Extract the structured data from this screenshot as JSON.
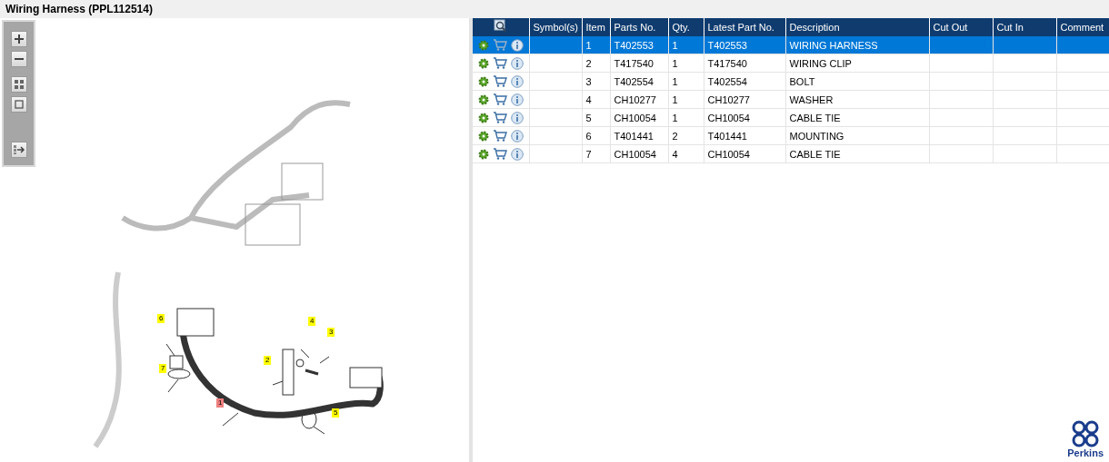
{
  "title": "Wiring Harness (PPL112514)",
  "callouts": [
    {
      "label": "1",
      "selected": true
    },
    {
      "label": "2",
      "selected": false
    },
    {
      "label": "3",
      "selected": false
    },
    {
      "label": "4",
      "selected": false
    },
    {
      "label": "5",
      "selected": false
    },
    {
      "label": "6",
      "selected": false
    },
    {
      "label": "7",
      "selected": false
    }
  ],
  "table": {
    "columns": [
      "Symbol(s)",
      "Item",
      "Parts No.",
      "Qty.",
      "Latest Part No.",
      "Description",
      "Cut Out",
      "Cut In",
      "Comment"
    ],
    "rows": [
      {
        "selected": true,
        "cells": [
          "",
          "1",
          "T402553",
          "1",
          "T402553",
          "WIRING HARNESS",
          "",
          "",
          ""
        ]
      },
      {
        "selected": false,
        "cells": [
          "",
          "2",
          "T417540",
          "1",
          "T417540",
          "WIRING CLIP",
          "",
          "",
          ""
        ]
      },
      {
        "selected": false,
        "cells": [
          "",
          "3",
          "T402554",
          "1",
          "T402554",
          "BOLT",
          "",
          "",
          ""
        ]
      },
      {
        "selected": false,
        "cells": [
          "",
          "4",
          "CH10277",
          "1",
          "CH10277",
          "WASHER",
          "",
          "",
          ""
        ]
      },
      {
        "selected": false,
        "cells": [
          "",
          "5",
          "CH10054",
          "1",
          "CH10054",
          "CABLE TIE",
          "",
          "",
          ""
        ]
      },
      {
        "selected": false,
        "cells": [
          "",
          "6",
          "T401441",
          "2",
          "T401441",
          "MOUNTING",
          "",
          "",
          ""
        ]
      },
      {
        "selected": false,
        "cells": [
          "",
          "7",
          "CH10054",
          "4",
          "CH10054",
          "CABLE TIE",
          "",
          "",
          ""
        ]
      }
    ]
  },
  "brand": "Perkins"
}
